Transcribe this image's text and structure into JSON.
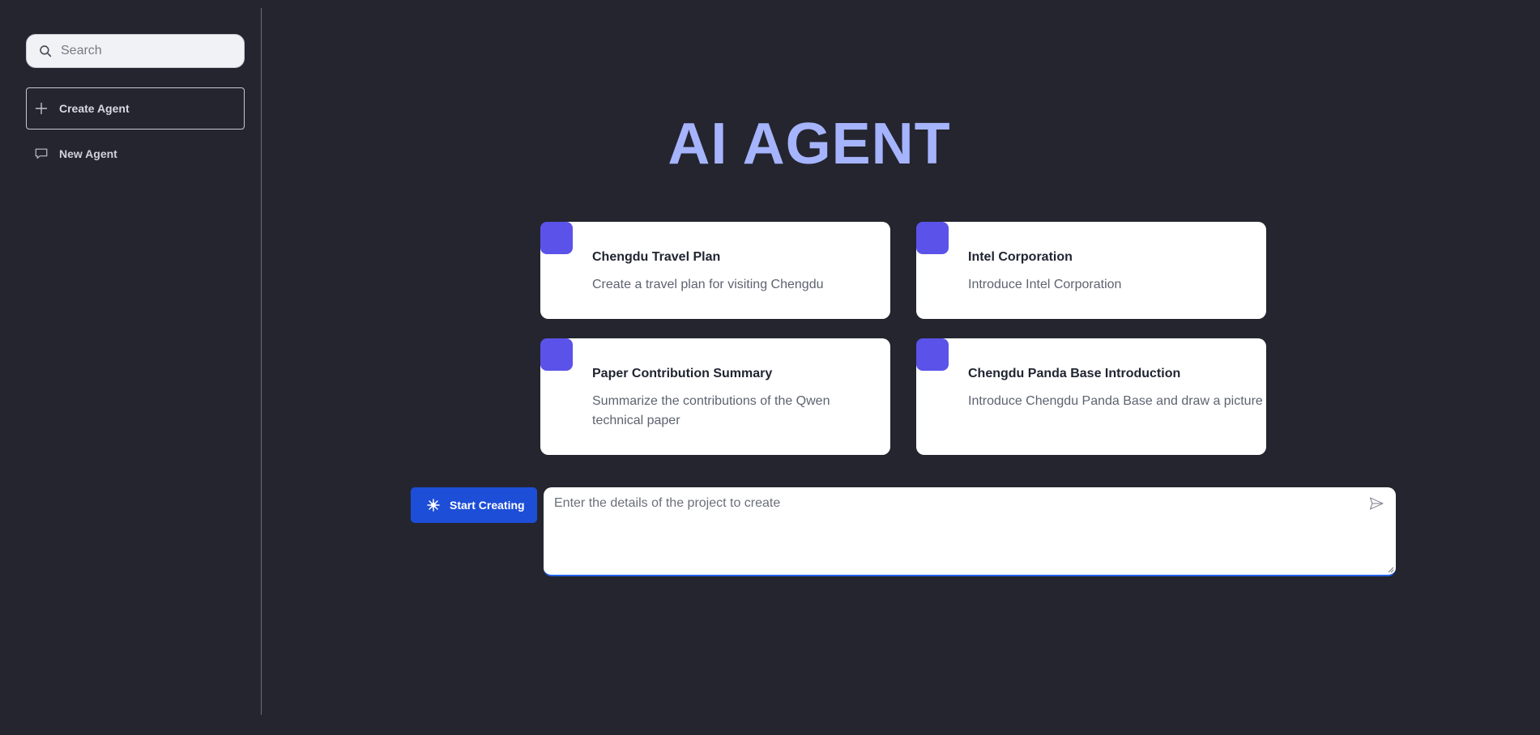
{
  "sidebar": {
    "search": {
      "placeholder": "Search",
      "value": ""
    },
    "create_agent_label": "Create Agent",
    "items": [
      {
        "label": "New Agent",
        "icon": "chat-bubble-icon"
      }
    ]
  },
  "main": {
    "title": "AI AGENT",
    "cards": [
      {
        "title": "Chengdu Travel Plan",
        "description": "Create a travel plan for visiting Chengdu"
      },
      {
        "title": "Intel Corporation",
        "description": "Introduce Intel Corporation"
      },
      {
        "title": "Paper Contribution Summary",
        "description": "Summarize the contributions of the Qwen technical paper"
      },
      {
        "title": "Chengdu Panda Base Introduction",
        "description": "Introduce Chengdu Panda Base and draw a picture"
      }
    ],
    "start_button_label": "Start Creating",
    "prompt": {
      "placeholder": "Enter the details of the project to create",
      "value": ""
    }
  },
  "colors": {
    "background": "#24252f",
    "title": "#a5b4fc",
    "card_badge": "#5b52e9",
    "primary_button": "#1d4ed8"
  }
}
